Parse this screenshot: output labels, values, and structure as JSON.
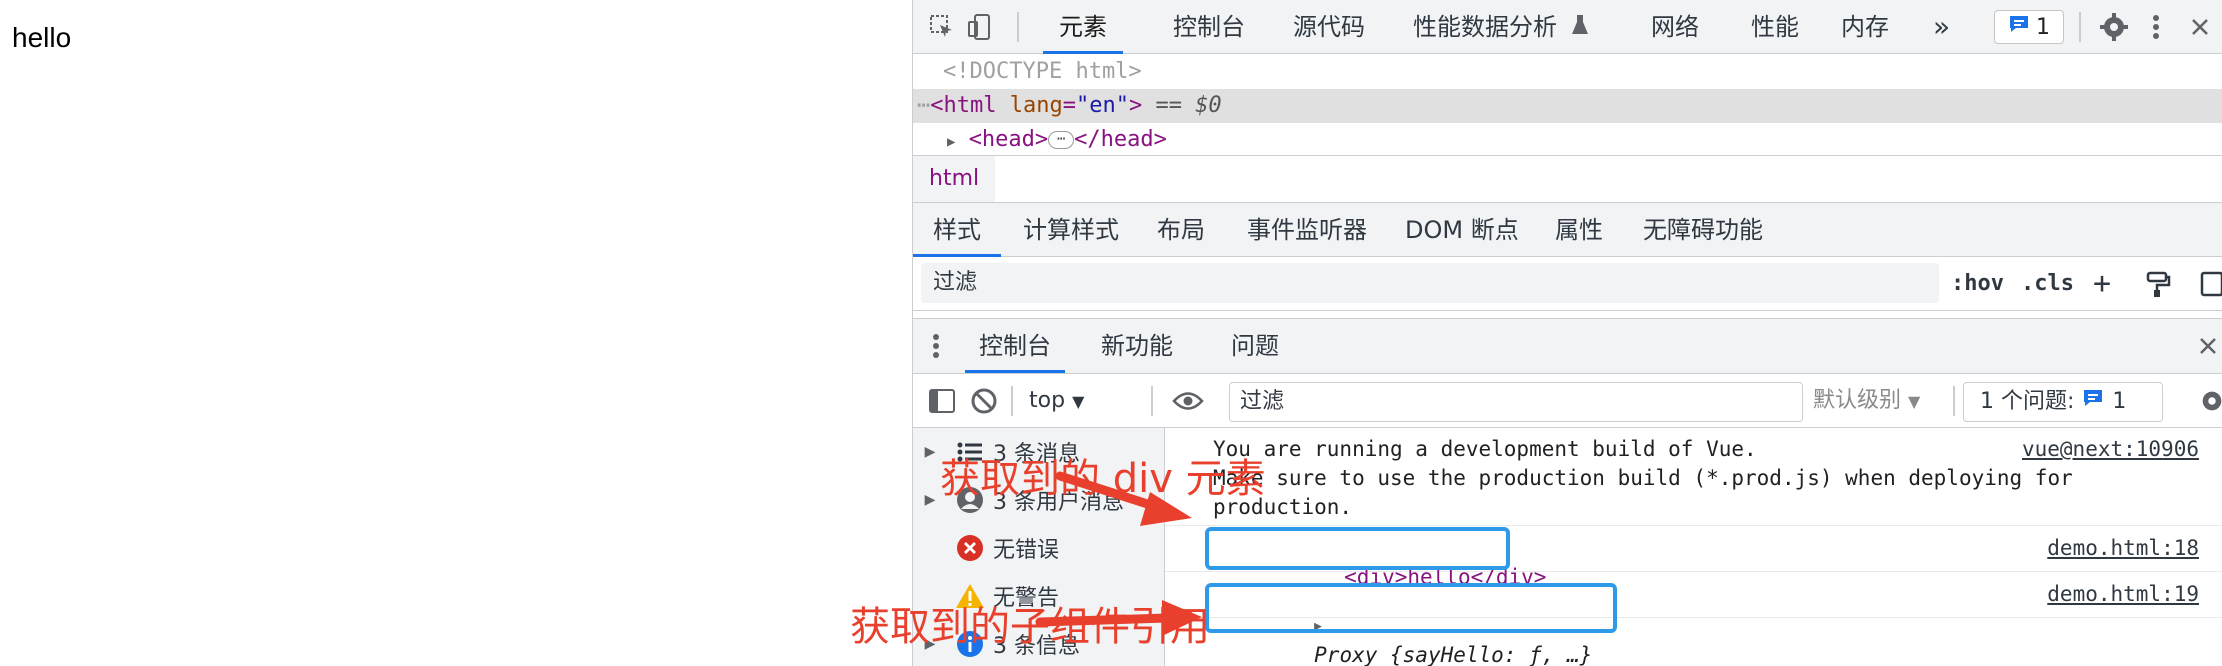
{
  "page": {
    "body_text": "hello"
  },
  "devtools": {
    "top_tabs": [
      "元素",
      "控制台",
      "源代码",
      "性能数据分析",
      "网络",
      "性能",
      "内存"
    ],
    "more_tabs": "»",
    "issues_count": "1",
    "dom": {
      "doctype": "<!DOCTYPE html>",
      "html_open": "<html",
      "html_attr_name": "lang",
      "html_attr_value": "\"en\"",
      "html_close": ">",
      "selected_ref": "== $0",
      "head_open": "<head>",
      "head_close": "</head>"
    },
    "breadcrumb": "html",
    "styles_tabs": [
      "样式",
      "计算样式",
      "布局",
      "事件监听器",
      "DOM 断点",
      "属性",
      "无障碍功能"
    ],
    "styles_filter_placeholder": "过滤",
    "hov": ":hov",
    "cls": ".cls",
    "drawer_tabs": [
      "控制台",
      "新功能",
      "问题"
    ],
    "console": {
      "context": "top",
      "filter_placeholder": "过滤",
      "level": "默认级别",
      "issues_label": "1 个问题:",
      "issues_count": "1",
      "sidebar": [
        {
          "label": "3 条消息",
          "icon": "list-icon"
        },
        {
          "label": "3 条用户消息",
          "icon": "user-icon"
        },
        {
          "label": "无错误",
          "icon": "error-icon"
        },
        {
          "label": "无警告",
          "icon": "warning-icon"
        },
        {
          "label": "3 条信息",
          "icon": "info-icon"
        }
      ],
      "messages": [
        {
          "line1": "You are running a development build of Vue.",
          "line2": "Make sure to use the production build (*.prod.js) when deploying for",
          "line3": "production.",
          "source": "vue@next:10906"
        },
        {
          "text": "<div>hello</div>",
          "source": "demo.html:18"
        },
        {
          "text": "Proxy {sayHello: ƒ, …}",
          "source": "demo.html:19"
        }
      ]
    }
  },
  "annotations": {
    "div_label": "获取到的 div 元素",
    "child_ref_label": "获取到的子组件引用"
  },
  "colors": {
    "accent": "#1a73e8",
    "annotation": "#e8402c",
    "highlight": "#2f9ae8"
  }
}
